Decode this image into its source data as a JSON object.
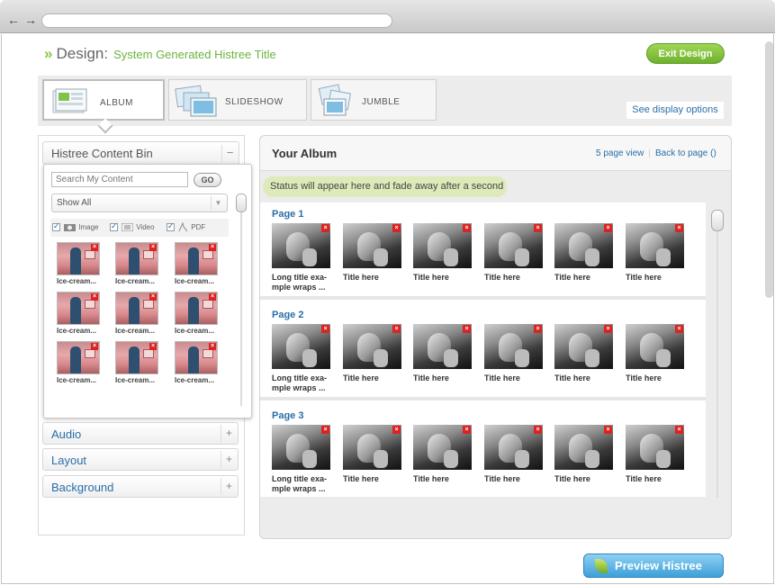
{
  "header": {
    "design_label": "Design:",
    "histree_title": "System Generated Histree Title",
    "exit_label": "Exit Design"
  },
  "tabs": [
    {
      "label": "ALBUM",
      "active": true
    },
    {
      "label": "SLIDESHOW",
      "active": false
    },
    {
      "label": "JUMBLE",
      "active": false
    }
  ],
  "display_options_label": "See display options",
  "content_bin": {
    "title": "Histree Content Bin",
    "toggle": "−",
    "search_placeholder": "Search My Content",
    "go_label": "GO",
    "filter_value": "Show All",
    "types": [
      {
        "label": "Image",
        "checked": true,
        "icon": "camera-icon"
      },
      {
        "label": "Video",
        "checked": true,
        "icon": "film-icon"
      },
      {
        "label": "PDF",
        "checked": true,
        "icon": "pdf-icon"
      }
    ],
    "items": [
      {
        "caption": "Ice-cream..."
      },
      {
        "caption": "Ice-cream..."
      },
      {
        "caption": "Ice-cream..."
      },
      {
        "caption": "Ice-cream..."
      },
      {
        "caption": "Ice-cream..."
      },
      {
        "caption": "Ice-cream..."
      },
      {
        "caption": "Ice-cream..."
      },
      {
        "caption": "Ice-cream..."
      },
      {
        "caption": "Ice-cream..."
      }
    ]
  },
  "accordion": [
    {
      "title": "Audio",
      "toggle": "+"
    },
    {
      "title": "Layout",
      "toggle": "+"
    },
    {
      "title": "Background",
      "toggle": "+"
    }
  ],
  "album": {
    "title": "Your Album",
    "view_link": "5 page view",
    "back_link": "Back to page ()",
    "status": "Status will appear here and fade away after a second",
    "pages": [
      {
        "label": "Page 1",
        "photos": [
          {
            "caption": "Long title exa-\nmple wraps ..."
          },
          {
            "caption": "Title here"
          },
          {
            "caption": "Title here"
          },
          {
            "caption": "Title here"
          },
          {
            "caption": "Title here"
          },
          {
            "caption": "Title here"
          }
        ]
      },
      {
        "label": "Page 2",
        "photos": [
          {
            "caption": "Long title exa-\nmple wraps ..."
          },
          {
            "caption": "Title here"
          },
          {
            "caption": "Title here"
          },
          {
            "caption": "Title here"
          },
          {
            "caption": "Title here"
          },
          {
            "caption": "Title here"
          }
        ]
      },
      {
        "label": "Page 3",
        "photos": [
          {
            "caption": "Long title exa-\nmple wraps ..."
          },
          {
            "caption": "Title here"
          },
          {
            "caption": "Title here"
          },
          {
            "caption": "Title here"
          },
          {
            "caption": "Title here"
          },
          {
            "caption": "Title here"
          }
        ]
      }
    ]
  },
  "preview_label": "Preview Histree",
  "colors": {
    "accent_green": "#6cb33e",
    "link_blue": "#2a6ea8",
    "status_bg": "#dcebb9",
    "preview_blue": "#3d9fd8"
  }
}
